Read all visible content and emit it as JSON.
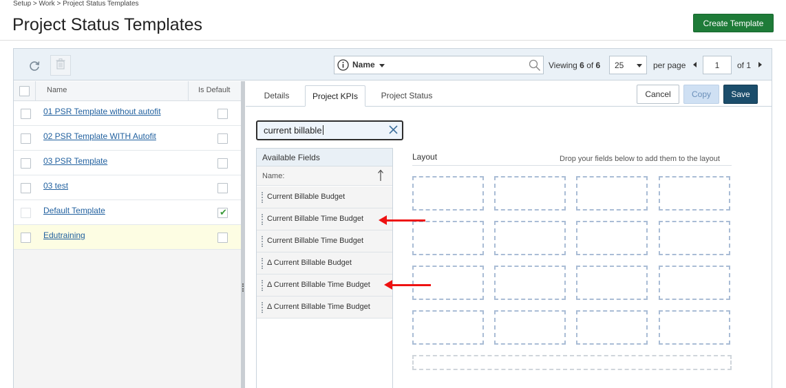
{
  "breadcrumb": "Setup > Work > Project Status Templates",
  "page_title": "Project Status Templates",
  "create_button": "Create Template",
  "toolbar": {
    "search_field": "Name",
    "viewing_prefix": "Viewing",
    "viewing_count": "6",
    "viewing_of": "of",
    "viewing_total": "6",
    "per_page_value": "25",
    "per_page_label": "per page",
    "page_value": "1",
    "page_of": "of 1"
  },
  "grid": {
    "col_name": "Name",
    "col_default": "Is Default",
    "rows": [
      {
        "name": "01 PSR Template without autofit",
        "is_default": false
      },
      {
        "name": "02 PSR Template WITH Autofit",
        "is_default": false
      },
      {
        "name": "03 PSR Template",
        "is_default": false
      },
      {
        "name": "03 test",
        "is_default": false
      },
      {
        "name": "Default Template",
        "is_default": true
      },
      {
        "name": "Edutraining",
        "is_default": false
      }
    ]
  },
  "tabs": [
    "Details",
    "Project KPIs",
    "Project Status"
  ],
  "active_tab": "Project KPIs",
  "actions": {
    "cancel": "Cancel",
    "copy": "Copy",
    "save": "Save"
  },
  "kpi_search_value": "current billable",
  "available_fields": {
    "title": "Available Fields",
    "name_header": "Name:",
    "items": [
      "Current Billable Budget",
      "Current Billable Time Budget",
      "Current Billable Time Budget",
      "Δ Current Billable Budget",
      "Δ Current Billable Time Budget",
      "Δ Current Billable Time Budget"
    ]
  },
  "layout": {
    "title": "Layout",
    "hint": "Drop your fields below to add them to the layout"
  },
  "colors": {
    "primary_green": "#1e7b38",
    "save_blue": "#1b4d6b",
    "link": "#1f5f9e",
    "annotation_arrow": "#e11111"
  }
}
